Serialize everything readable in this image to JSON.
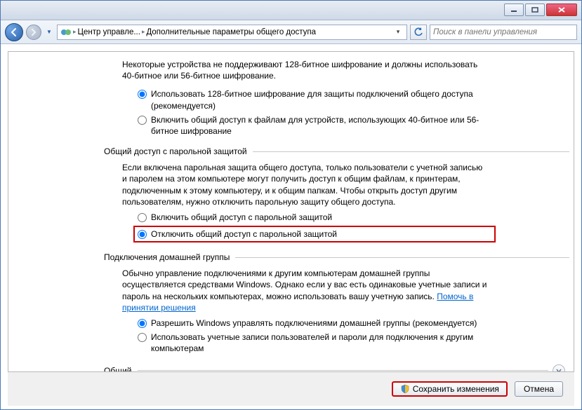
{
  "nav": {
    "breadcrumb1": "Центр управле...",
    "breadcrumb2": "Дополнительные параметры общего доступа",
    "search_placeholder": "Поиск в панели управления"
  },
  "encryption": {
    "intro": "Некоторые устройства не поддерживают 128-битное шифрование и должны использовать 40-битное или 56-битное шифрование.",
    "opt1": "Использовать 128-битное шифрование для защиты подключений общего доступа (рекомендуется)",
    "opt2": "Включить общий доступ к файлам для устройств, использующих 40-битное или 56-битное шифрование"
  },
  "password": {
    "heading": "Общий доступ с парольной защитой",
    "intro": "Если включена парольная защита общего доступа, только пользователи с учетной записью и паролем на этом компьютере могут получить доступ к общим файлам, к принтерам, подключенным к этому компьютеру, и к общим папкам. Чтобы открыть доступ другим пользователям, нужно отключить парольную защиту общего доступа.",
    "opt1": "Включить общий доступ с парольной защитой",
    "opt2": "Отключить общий доступ с парольной защитой"
  },
  "homegroup": {
    "heading": "Подключения домашней группы",
    "intro_prefix": "Обычно управление подключениями к другим компьютерам домашней группы осуществляется средствами Windows. Однако если у вас есть одинаковые учетные записи и пароль на нескольких компьютерах, можно использовать вашу учетную запись. ",
    "link": "Помочь в принятии решения",
    "opt1": "Разрешить Windows управлять подключениями домашней группы (рекомендуется)",
    "opt2": "Использовать учетные записи пользователей и пароли для подключения к другим компьютерам"
  },
  "general": {
    "heading": "Общий"
  },
  "footer": {
    "save": "Сохранить изменения",
    "cancel": "Отмена"
  }
}
